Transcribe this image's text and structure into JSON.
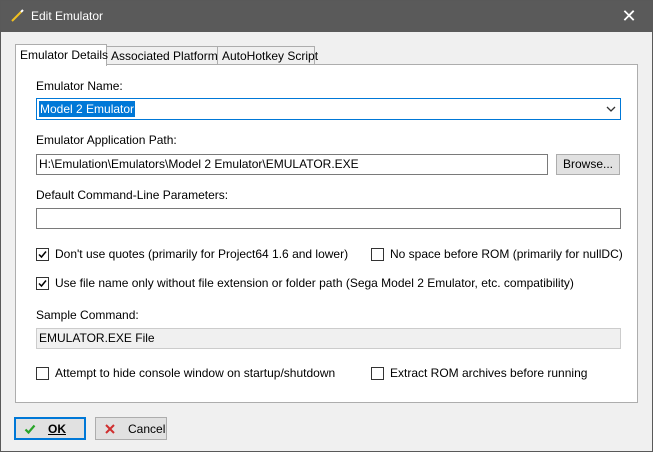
{
  "window": {
    "title": "Edit Emulator"
  },
  "tabs": [
    {
      "label": "Emulator Details"
    },
    {
      "label": "Associated Platforms"
    },
    {
      "label": "AutoHotkey Script"
    }
  ],
  "details": {
    "name_label": "Emulator Name:",
    "name_value": "Model 2 Emulator",
    "path_label": "Emulator Application Path:",
    "path_value": "H:\\Emulation\\Emulators\\Model 2 Emulator\\EMULATOR.EXE",
    "browse_label": "Browse...",
    "params_label": "Default Command-Line Parameters:",
    "params_value": "",
    "checkboxes": {
      "no_quotes": {
        "label": "Don't use quotes (primarily for Project64 1.6 and lower)",
        "checked": true
      },
      "no_space": {
        "label": "No space before ROM (primarily for nullDC)",
        "checked": false
      },
      "filename_only": {
        "label": "Use file name only without file extension or folder path (Sega Model 2 Emulator, etc. compatibility)",
        "checked": true
      },
      "hide_console": {
        "label": "Attempt to hide console window on startup/shutdown",
        "checked": false
      },
      "extract_rom": {
        "label": "Extract ROM archives before running",
        "checked": false
      }
    },
    "sample_label": "Sample Command:",
    "sample_value": "EMULATOR.EXE File"
  },
  "footer": {
    "ok_label": "OK",
    "cancel_label": "Cancel"
  },
  "colors": {
    "titlebar": "#5a5a5a",
    "accent": "#0078d7",
    "ok_icon": "#2aa52a",
    "cancel_icon": "#d03030"
  }
}
